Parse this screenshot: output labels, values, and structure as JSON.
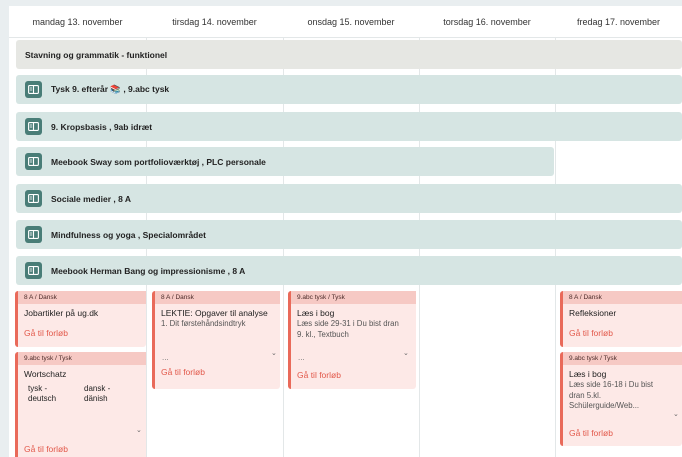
{
  "days": [
    "mandag 13. november",
    "tirsdag 14. november",
    "onsdag 15. november",
    "torsdag 16. november",
    "fredag 17. november"
  ],
  "bars": [
    "Stavning og grammatik - funktionel",
    "Tysk 9. efterår 📚 , 9.abc tysk",
    "9. Kropsbasis , 9ab idræt",
    "Meebook Sway som portfolioværktøj , PLC personale",
    "Sociale medier , 8 A",
    "Mindfulness og yoga , Specialområdet",
    "Meebook Herman Bang og impressionisme , 8 A"
  ],
  "colors": {
    "accent": "#e96a5a",
    "link": "#e2584a",
    "teal_bar": "#d6e5e3",
    "grey_bar": "#e6e7e3",
    "icon_bg": "#497d77"
  },
  "icons": {
    "bar_icon": "book-open-icon",
    "expand": "chevron-down-icon"
  },
  "cards": {
    "mon1": {
      "header": "8 A / Dansk",
      "title": "Jobartikler på ug.dk",
      "link": "Gå til forløb"
    },
    "mon2": {
      "header": "9.abc tysk / Tysk",
      "title": "Wortschatz",
      "col1": "tysk -\ndeutsch",
      "col2": "dansk -\ndänish",
      "link": "Gå til forløb"
    },
    "tue1": {
      "header": "8 A / Dansk",
      "title": "LEKTIE: Opgaver til analyse",
      "sub": "1. Dit førstehåndsindtryk",
      "dots": "...",
      "link": "Gå til forløb"
    },
    "wed1": {
      "header": "9.abc tysk / Tysk",
      "title": "Læs i bog",
      "sub": "Læs side 29-31 i Du bist dran 9. kl., Textbuch",
      "dots": "...",
      "link": "Gå til forløb"
    },
    "fri1": {
      "header": "8 A / Dansk",
      "title": "Refleksioner",
      "link": "Gå til forløb"
    },
    "fri2": {
      "header": "9.abc tysk / Tysk",
      "title": "Læs i bog",
      "sub": "Læs side 16-18 i Du bist dran 5.kl. Schülerguide/Web...",
      "link": "Gå til forløb"
    }
  }
}
